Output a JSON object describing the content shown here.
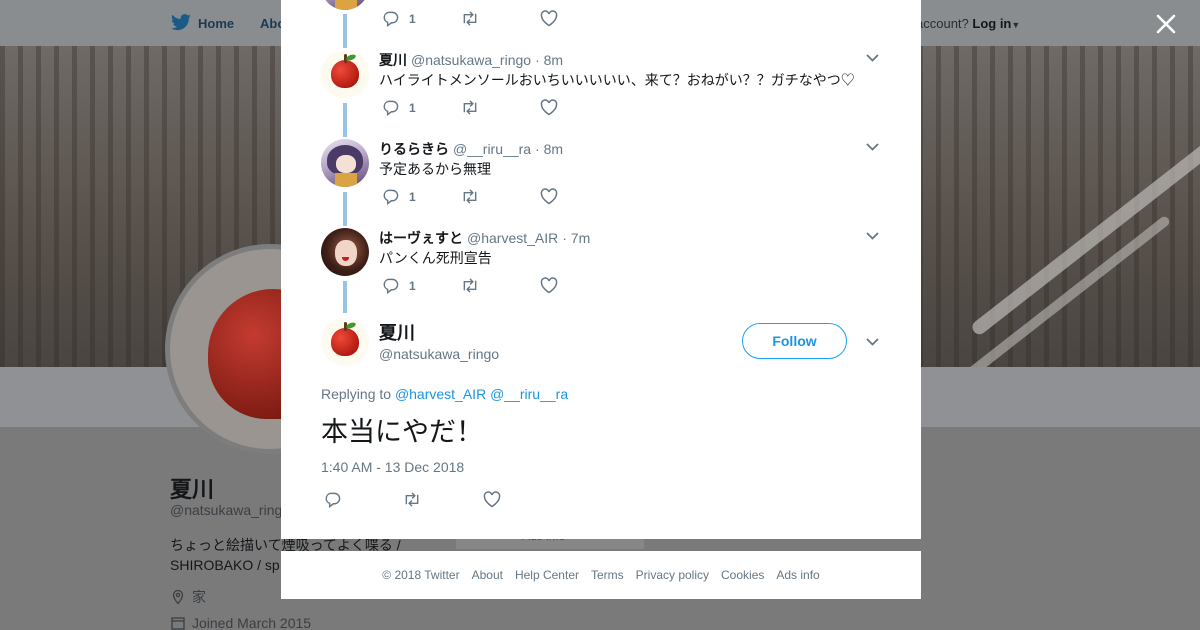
{
  "background": {
    "nav": {
      "home": "Home",
      "about": "Abo",
      "account_prompt": "account?",
      "login": "Log in"
    },
    "profile": {
      "name": "夏川",
      "handle": "@natsukawa_ringo",
      "bio_line1": "ちょっと絵描いて煙吸ってよく喋る /",
      "bio_line2": "SHIROBAKO / sp",
      "location": "家",
      "joined": "Joined March 2015"
    },
    "ads_info": "Ads info"
  },
  "modal": {
    "thread": [
      {
        "name": "",
        "handle": "",
        "time": "",
        "text": "",
        "reply_count": "1"
      },
      {
        "name": "夏川",
        "handle": "@natsukawa_ringo",
        "time": "· 8m",
        "text": "ハイライトメンソールおいちいいいいい、来て？おねがい？？ガチなやつ♡",
        "reply_count": "1"
      },
      {
        "name": "りるらきら",
        "handle": "@__riru__ra",
        "time": "· 8m",
        "text": "予定あるから無理",
        "reply_count": "1"
      },
      {
        "name": "はーヴぇすと",
        "handle": "@harvest_AIR",
        "time": "· 7m",
        "text": "パンくん死刑宣告",
        "reply_count": "1"
      }
    ],
    "main_tweet": {
      "name": "夏川",
      "handle": "@natsukawa_ringo",
      "follow_label": "Follow",
      "replying_to_label": "Replying to",
      "replying_to": [
        "@harvest_AIR",
        "@__riru__ra"
      ],
      "text": "本当にやだ！",
      "timestamp": "1:40 AM - 13 Dec 2018"
    }
  },
  "footer": {
    "links": [
      "© 2018 Twitter",
      "About",
      "Help Center",
      "Terms",
      "Privacy policy",
      "Cookies",
      "Ads info"
    ]
  },
  "colors": {
    "accent": "#1da1f2",
    "link": "#1b95e0",
    "thread_line": "#97c4e6",
    "muted_text": "#657786"
  },
  "icons": [
    "twitter-bird-icon",
    "close-icon",
    "reply-icon",
    "retweet-icon",
    "like-icon",
    "chevron-down-icon",
    "location-icon",
    "calendar-icon"
  ]
}
